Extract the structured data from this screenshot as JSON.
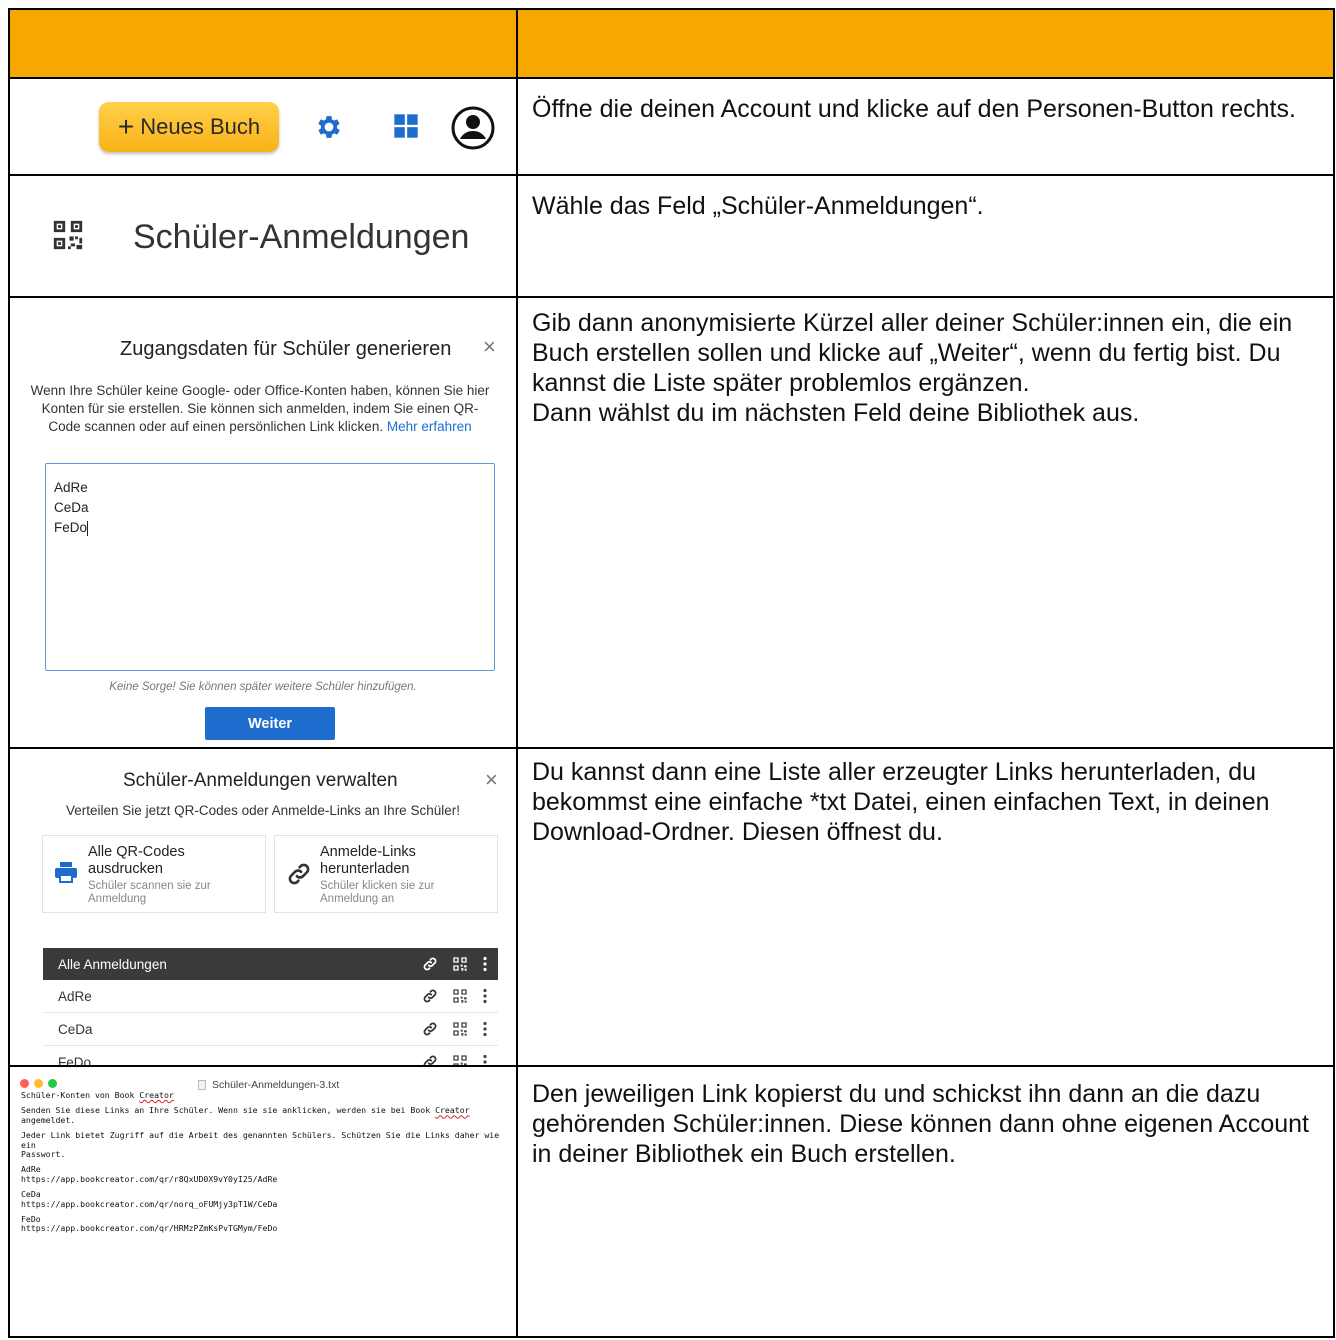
{
  "rows": [
    {
      "description": "Öffne die deinen Account und klicke auf den Personen-Button rechts.",
      "toolbar": {
        "new_book_plus": "+",
        "new_book_label": "Neues Buch"
      }
    },
    {
      "description": "Wähle das Feld „Schüler-Anmeldungen“.",
      "menu_label": "Schüler-Anmeldungen"
    },
    {
      "description_lines": [
        "Gib dann anonymisierte Kürzel aller deiner Schüler:innen ein, die ein Buch erstellen sollen und klicke auf „Weiter“, wenn du fertig bist. Du kannst die Liste später problemlos ergänzen.",
        "Dann wählst du im nächsten Feld deine Bibliothek aus."
      ],
      "dialog": {
        "title": "Zugangsdaten für Schüler generieren",
        "close": "×",
        "info": "Wenn Ihre Schüler keine Google- oder Office-Konten haben, können Sie hier Konten für sie erstellen. Sie können sich anmelden, indem Sie einen QR-Code scannen oder auf einen persönlichen Link klicken.",
        "info_link": "Mehr erfahren",
        "entries": [
          "AdRe",
          "CeDa",
          "FeDo"
        ],
        "hint": "Keine Sorge! Sie können später weitere Schüler hinzufügen.",
        "button": "Weiter"
      }
    },
    {
      "description": "Du kannst dann eine Liste aller erzeugter Links herunterladen, du bekommst eine einfache *txt Datei, einen einfachen Text, in deinen Download-Ordner. Diesen öffnest du.",
      "dialog": {
        "title": "Schüler-Anmeldungen verwalten",
        "close": "×",
        "subtitle": "Verteilen Sie jetzt QR-Codes oder Anmelde-Links an Ihre Schüler!",
        "cards": [
          {
            "title": "Alle QR-Codes ausdrucken",
            "subtitle": "Schüler scannen sie zur Anmeldung",
            "icon": "printer-icon"
          },
          {
            "title": "Anmelde-Links herunterladen",
            "subtitle": "Schüler klicken sie zur Anmeldung an",
            "icon": "link-icon"
          }
        ],
        "list_header": "Alle Anmeldungen",
        "list_items": [
          "AdRe",
          "CeDa",
          "FeDo"
        ]
      }
    },
    {
      "description": "Den jeweiligen Link kopierst du und schickst ihn dann an die dazu gehörenden Schüler:innen. Diese können dann ohne eigenen Account in deiner Bibliothek ein Buch erstellen.",
      "textfile": {
        "window_title": "Schüler-Anmeldungen-3.txt",
        "heading_pre": "Schüler-Konten von Book ",
        "heading_brand": "Creator",
        "para1_pre": "Senden Sie diese Links an Ihre Schüler. Wenn sie sie anklicken, werden sie bei Book ",
        "para1_brand": "Creator",
        "para1_post": "\nangemeldet.",
        "para2": "Jeder Link bietet Zugriff auf die Arbeit des genannten Schülers. Schützen Sie die Links daher wie ein\nPasswort.",
        "entries": [
          {
            "name": "AdRe",
            "url": "https://app.bookcreator.com/qr/r8QxUD0X9vY0yI25/AdRe"
          },
          {
            "name": "CeDa",
            "url": "https://app.bookcreator.com/qr/norq_oFUMjy3pT1W/CeDa"
          },
          {
            "name": "FeDo",
            "url": "https://app.bookcreator.com/qr/HRMzPZmKsPvTGMym/FeDo"
          }
        ]
      }
    }
  ],
  "colors": {
    "header_orange": "#f6a800",
    "button_yellow": "#fbbd2b",
    "icon_blue": "#1e6dce",
    "list_header": "#3a3a3a",
    "dot_red": "#fe5f57",
    "dot_yellow": "#febc2e",
    "dot_green": "#28c840"
  }
}
